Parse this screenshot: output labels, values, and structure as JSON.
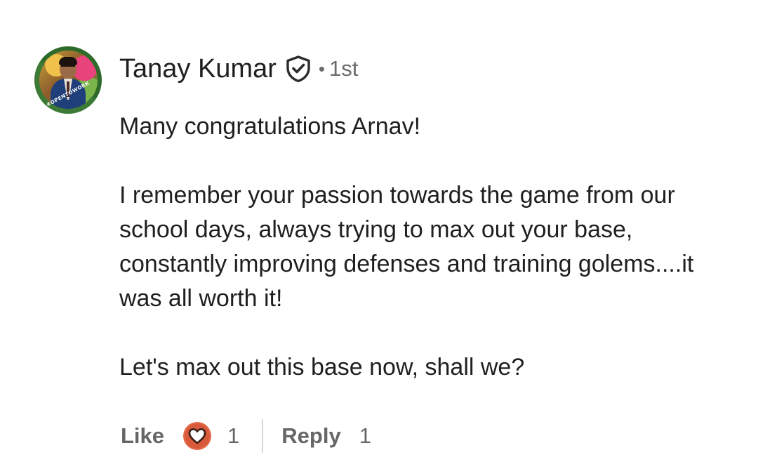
{
  "comment": {
    "author": {
      "name": "Tanay Kumar",
      "degree": "1st",
      "separator": "•",
      "avatar_badge": "#OPENTOWORK",
      "verified_icon": "shield-check-icon"
    },
    "body": {
      "paragraphs": [
        "Many congratulations Arnav!",
        "I remember your passion towards the game from our school days, always trying to max out your base, constantly improving defenses and training golems....it was all worth it!",
        "Let's max out this base now, shall we?"
      ]
    },
    "actions": {
      "like_label": "Like",
      "like_reaction_icon": "heart-reaction-icon",
      "like_count": "1",
      "reply_label": "Reply",
      "reply_count": "1"
    }
  },
  "colors": {
    "text": "#1f1f1f",
    "muted": "#666666",
    "reaction_orange": "#e16745",
    "badge_green": "#3c7a36"
  }
}
